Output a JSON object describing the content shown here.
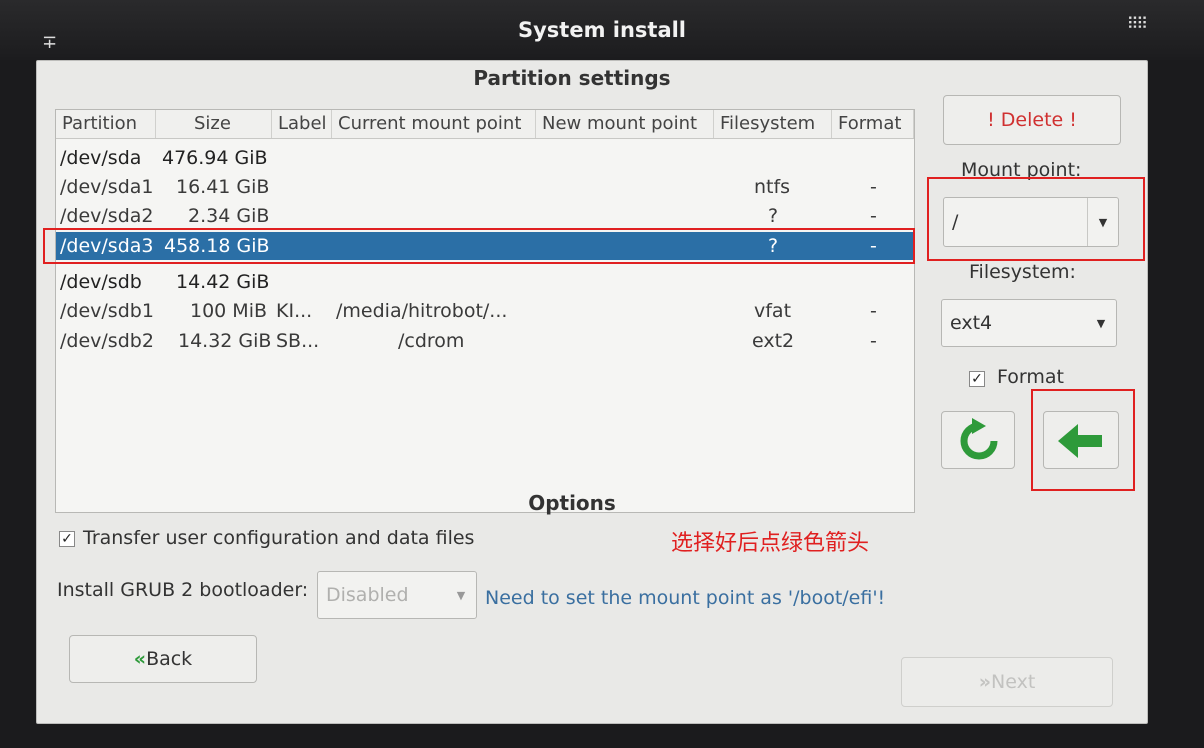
{
  "window": {
    "title": "System install"
  },
  "partition": {
    "title": "Partition settings",
    "columns": [
      "Partition",
      "Size",
      "Label",
      "Current mount point",
      "New mount point",
      "Filesystem",
      "Format"
    ],
    "rows": [
      {
        "partition": "/dev/sda",
        "size": "476.94 GiB",
        "label": "",
        "current": "",
        "new": "",
        "fs": "",
        "format": ""
      },
      {
        "partition": "/dev/sda1",
        "size": "16.41 GiB",
        "label": "",
        "current": "",
        "new": "",
        "fs": "ntfs",
        "format": "-"
      },
      {
        "partition": "/dev/sda2",
        "size": "2.34 GiB",
        "label": "",
        "current": "",
        "new": "",
        "fs": "?",
        "format": "-"
      },
      {
        "partition": "/dev/sda3",
        "size": "458.18 GiB",
        "label": "",
        "current": "",
        "new": "",
        "fs": "?",
        "format": "-"
      },
      {
        "partition": "/dev/sdb",
        "size": "14.42 GiB",
        "label": "",
        "current": "",
        "new": "",
        "fs": "",
        "format": ""
      },
      {
        "partition": "/dev/sdb1",
        "size": "100 MiB",
        "label": "KI...",
        "current": "/media/hitrobot/...",
        "new": "",
        "fs": "vfat",
        "format": "-"
      },
      {
        "partition": "/dev/sdb2",
        "size": "14.32 GiB",
        "label": "SB...",
        "current": "/cdrom",
        "new": "",
        "fs": "ext2",
        "format": "-"
      }
    ],
    "selected_row": "/dev/sda3"
  },
  "side": {
    "delete_label": "! Delete !",
    "mount_point_label": "Mount point:",
    "mount_point_value": "/",
    "filesystem_label": "Filesystem:",
    "filesystem_value": "ext4",
    "format_label": "Format",
    "format_checked": true
  },
  "options": {
    "title": "Options",
    "transfer_label": "Transfer user configuration and data files",
    "transfer_checked": true,
    "grub_label": "Install GRUB 2 bootloader:",
    "grub_value": "Disabled",
    "hint": "Need to set the mount point as '/boot/efi'!"
  },
  "annotation": "选择好后点绿色箭头",
  "nav": {
    "back_label": "Back",
    "next_label": "Next"
  },
  "colors": {
    "selection": "#2b6fa6",
    "highlight": "#e02020",
    "arrow_green": "#2e9a3a",
    "hint": "#3a6fa0"
  }
}
